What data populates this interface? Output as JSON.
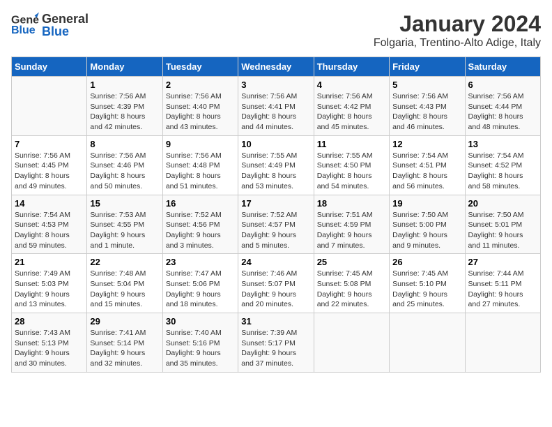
{
  "logo": {
    "general": "General",
    "blue": "Blue"
  },
  "title": "January 2024",
  "subtitle": "Folgaria, Trentino-Alto Adige, Italy",
  "days_of_week": [
    "Sunday",
    "Monday",
    "Tuesday",
    "Wednesday",
    "Thursday",
    "Friday",
    "Saturday"
  ],
  "weeks": [
    [
      {
        "day": "",
        "info": ""
      },
      {
        "day": "1",
        "info": "Sunrise: 7:56 AM\nSunset: 4:39 PM\nDaylight: 8 hours\nand 42 minutes."
      },
      {
        "day": "2",
        "info": "Sunrise: 7:56 AM\nSunset: 4:40 PM\nDaylight: 8 hours\nand 43 minutes."
      },
      {
        "day": "3",
        "info": "Sunrise: 7:56 AM\nSunset: 4:41 PM\nDaylight: 8 hours\nand 44 minutes."
      },
      {
        "day": "4",
        "info": "Sunrise: 7:56 AM\nSunset: 4:42 PM\nDaylight: 8 hours\nand 45 minutes."
      },
      {
        "day": "5",
        "info": "Sunrise: 7:56 AM\nSunset: 4:43 PM\nDaylight: 8 hours\nand 46 minutes."
      },
      {
        "day": "6",
        "info": "Sunrise: 7:56 AM\nSunset: 4:44 PM\nDaylight: 8 hours\nand 48 minutes."
      }
    ],
    [
      {
        "day": "7",
        "info": "Sunrise: 7:56 AM\nSunset: 4:45 PM\nDaylight: 8 hours\nand 49 minutes."
      },
      {
        "day": "8",
        "info": "Sunrise: 7:56 AM\nSunset: 4:46 PM\nDaylight: 8 hours\nand 50 minutes."
      },
      {
        "day": "9",
        "info": "Sunrise: 7:56 AM\nSunset: 4:48 PM\nDaylight: 8 hours\nand 51 minutes."
      },
      {
        "day": "10",
        "info": "Sunrise: 7:55 AM\nSunset: 4:49 PM\nDaylight: 8 hours\nand 53 minutes."
      },
      {
        "day": "11",
        "info": "Sunrise: 7:55 AM\nSunset: 4:50 PM\nDaylight: 8 hours\nand 54 minutes."
      },
      {
        "day": "12",
        "info": "Sunrise: 7:54 AM\nSunset: 4:51 PM\nDaylight: 8 hours\nand 56 minutes."
      },
      {
        "day": "13",
        "info": "Sunrise: 7:54 AM\nSunset: 4:52 PM\nDaylight: 8 hours\nand 58 minutes."
      }
    ],
    [
      {
        "day": "14",
        "info": "Sunrise: 7:54 AM\nSunset: 4:53 PM\nDaylight: 8 hours\nand 59 minutes."
      },
      {
        "day": "15",
        "info": "Sunrise: 7:53 AM\nSunset: 4:55 PM\nDaylight: 9 hours\nand 1 minute."
      },
      {
        "day": "16",
        "info": "Sunrise: 7:52 AM\nSunset: 4:56 PM\nDaylight: 9 hours\nand 3 minutes."
      },
      {
        "day": "17",
        "info": "Sunrise: 7:52 AM\nSunset: 4:57 PM\nDaylight: 9 hours\nand 5 minutes."
      },
      {
        "day": "18",
        "info": "Sunrise: 7:51 AM\nSunset: 4:59 PM\nDaylight: 9 hours\nand 7 minutes."
      },
      {
        "day": "19",
        "info": "Sunrise: 7:50 AM\nSunset: 5:00 PM\nDaylight: 9 hours\nand 9 minutes."
      },
      {
        "day": "20",
        "info": "Sunrise: 7:50 AM\nSunset: 5:01 PM\nDaylight: 9 hours\nand 11 minutes."
      }
    ],
    [
      {
        "day": "21",
        "info": "Sunrise: 7:49 AM\nSunset: 5:03 PM\nDaylight: 9 hours\nand 13 minutes."
      },
      {
        "day": "22",
        "info": "Sunrise: 7:48 AM\nSunset: 5:04 PM\nDaylight: 9 hours\nand 15 minutes."
      },
      {
        "day": "23",
        "info": "Sunrise: 7:47 AM\nSunset: 5:06 PM\nDaylight: 9 hours\nand 18 minutes."
      },
      {
        "day": "24",
        "info": "Sunrise: 7:46 AM\nSunset: 5:07 PM\nDaylight: 9 hours\nand 20 minutes."
      },
      {
        "day": "25",
        "info": "Sunrise: 7:45 AM\nSunset: 5:08 PM\nDaylight: 9 hours\nand 22 minutes."
      },
      {
        "day": "26",
        "info": "Sunrise: 7:45 AM\nSunset: 5:10 PM\nDaylight: 9 hours\nand 25 minutes."
      },
      {
        "day": "27",
        "info": "Sunrise: 7:44 AM\nSunset: 5:11 PM\nDaylight: 9 hours\nand 27 minutes."
      }
    ],
    [
      {
        "day": "28",
        "info": "Sunrise: 7:43 AM\nSunset: 5:13 PM\nDaylight: 9 hours\nand 30 minutes."
      },
      {
        "day": "29",
        "info": "Sunrise: 7:41 AM\nSunset: 5:14 PM\nDaylight: 9 hours\nand 32 minutes."
      },
      {
        "day": "30",
        "info": "Sunrise: 7:40 AM\nSunset: 5:16 PM\nDaylight: 9 hours\nand 35 minutes."
      },
      {
        "day": "31",
        "info": "Sunrise: 7:39 AM\nSunset: 5:17 PM\nDaylight: 9 hours\nand 37 minutes."
      },
      {
        "day": "",
        "info": ""
      },
      {
        "day": "",
        "info": ""
      },
      {
        "day": "",
        "info": ""
      }
    ]
  ]
}
